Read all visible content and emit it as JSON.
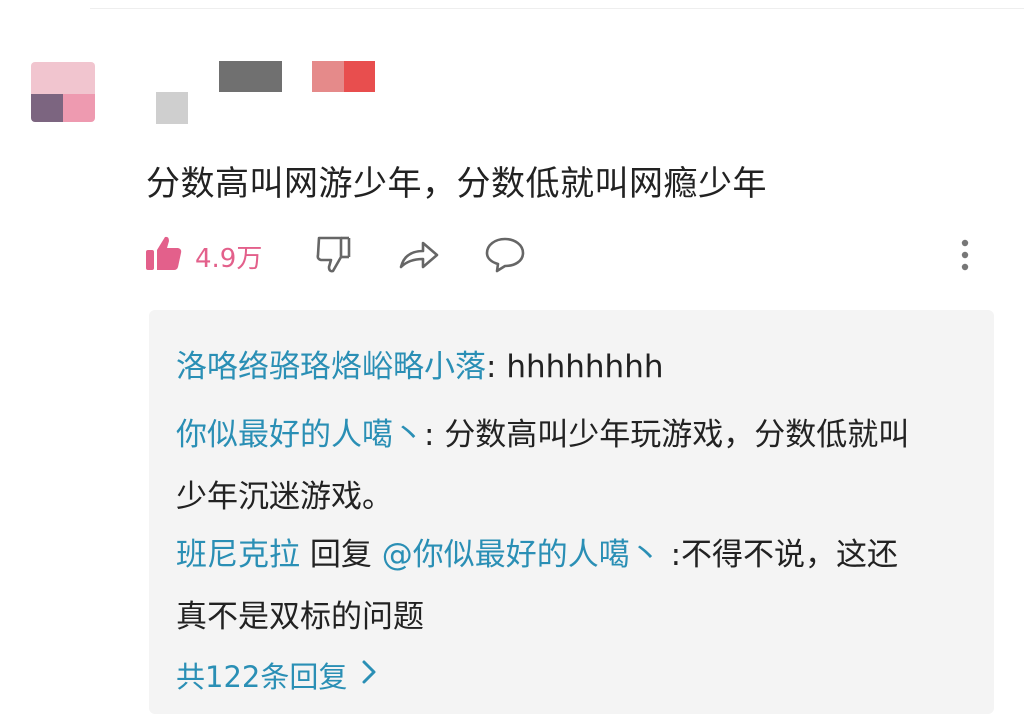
{
  "comment": {
    "text": "分数高叫网游少年，分数低就叫网瘾少年",
    "like_count": "4.9万"
  },
  "icons": [
    "thumb-up-icon",
    "thumb-down-icon",
    "share-icon",
    "reply-bubble-icon",
    "more-vertical-icon",
    "chevron-right-icon"
  ],
  "colors": {
    "accent_pink": "#e3608b",
    "username_blue": "#2a8fb5",
    "reply_bg": "#f4f4f4"
  },
  "replies": [
    {
      "user": "洛咯络骆珞烙峪略小落",
      "sep": ": ",
      "text": "hhhhhhhh"
    },
    {
      "user": "你似最好的人噶丶",
      "sep": ": ",
      "text": "分数高叫少年玩游戏，分数低就叫少年沉迷游戏。"
    },
    {
      "user": "班尼克拉",
      "reply_word": " 回复 ",
      "mention": "@你似最好的人噶丶",
      "sep": " :",
      "text": "不得不说，这还真不是双标的问题"
    }
  ],
  "more_replies_label": "共122条回复"
}
